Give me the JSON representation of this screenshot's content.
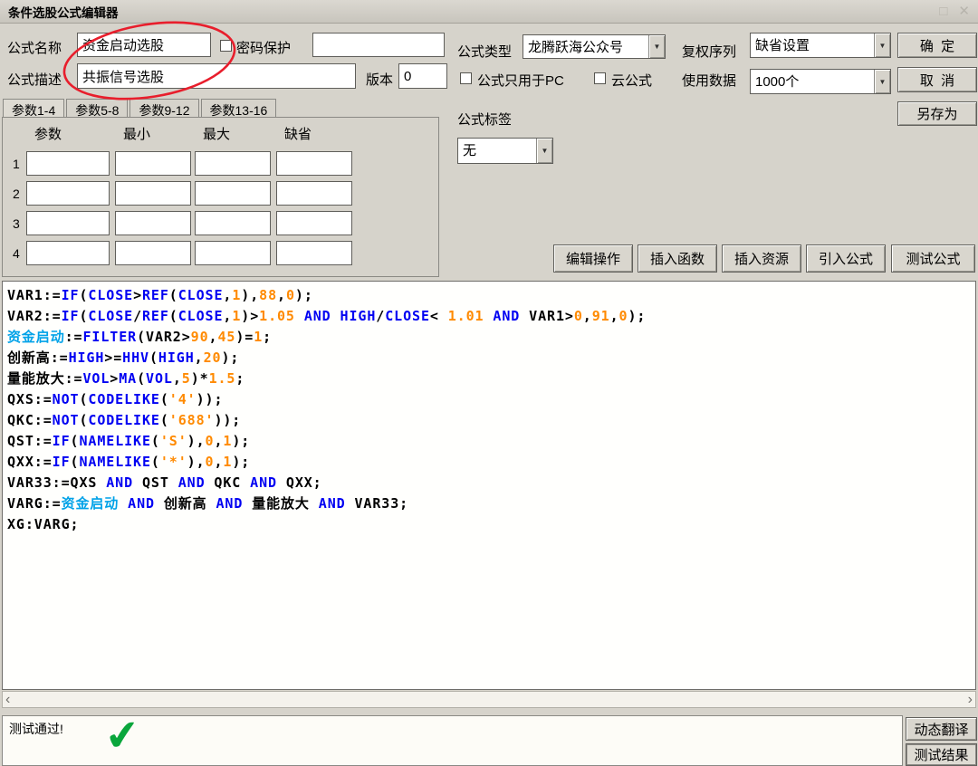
{
  "window": {
    "title": "条件选股公式编辑器",
    "maximize_icon": "□",
    "close_icon": "✕"
  },
  "form": {
    "name": {
      "label": "公式名称",
      "value": "资金启动选股"
    },
    "password": {
      "label": "密码保护",
      "value": "",
      "checked": false
    },
    "desc": {
      "label": "公式描述",
      "value": "共振信号选股"
    },
    "version": {
      "label": "版本",
      "value": "0"
    },
    "type": {
      "label": "公式类型",
      "value": "龙腾跃海公众号"
    },
    "adjust": {
      "label": "复权序列",
      "value": "缺省设置"
    },
    "pc_only": {
      "label": "公式只用于PC",
      "checked": false
    },
    "cloud": {
      "label": "云公式",
      "checked": false
    },
    "data_count": {
      "label": "使用数据",
      "value": "1000个"
    },
    "tag": {
      "label": "公式标签",
      "value": "无"
    }
  },
  "buttons": {
    "ok": "确  定",
    "cancel": "取  消",
    "save_as": "另存为",
    "edit_op": "编辑操作",
    "insert_func": "插入函数",
    "insert_res": "插入资源",
    "import_formula": "引入公式",
    "test_formula": "测试公式",
    "dyn_translate": "动态翻译",
    "test_result": "测试结果"
  },
  "tabs": [
    {
      "label": "参数1-4",
      "active": true
    },
    {
      "label": "参数5-8",
      "active": false
    },
    {
      "label": "参数9-12",
      "active": false
    },
    {
      "label": "参数13-16",
      "active": false
    }
  ],
  "param_table": {
    "headers": [
      "参数",
      "最小",
      "最大",
      "缺省"
    ],
    "row_labels": [
      "1",
      "2",
      "3",
      "4"
    ]
  },
  "code": {
    "lines": [
      [
        [
          "VAR1:=",
          "p"
        ],
        [
          "IF",
          "k"
        ],
        [
          "(",
          "p"
        ],
        [
          "CLOSE",
          "k"
        ],
        [
          ">",
          "p"
        ],
        [
          "REF",
          "k"
        ],
        [
          "(",
          "p"
        ],
        [
          "CLOSE",
          "k"
        ],
        [
          ",",
          "p"
        ],
        [
          "1",
          "n"
        ],
        [
          "),",
          "p"
        ],
        [
          "88",
          "n"
        ],
        [
          ",",
          "p"
        ],
        [
          "0",
          "n"
        ],
        [
          ");",
          "p"
        ]
      ],
      [
        [
          "VAR2:=",
          "p"
        ],
        [
          "IF",
          "k"
        ],
        [
          "(",
          "p"
        ],
        [
          "CLOSE",
          "k"
        ],
        [
          "/",
          "p"
        ],
        [
          "REF",
          "k"
        ],
        [
          "(",
          "p"
        ],
        [
          "CLOSE",
          "k"
        ],
        [
          ",",
          "p"
        ],
        [
          "1",
          "n"
        ],
        [
          ")>",
          "p"
        ],
        [
          "1.05",
          "n"
        ],
        [
          " ",
          "p"
        ],
        [
          "AND",
          "k"
        ],
        [
          " ",
          "p"
        ],
        [
          "HIGH",
          "k"
        ],
        [
          "/",
          "p"
        ],
        [
          "CLOSE",
          "k"
        ],
        [
          "< ",
          "p"
        ],
        [
          "1.01",
          "n"
        ],
        [
          " ",
          "p"
        ],
        [
          "AND",
          "k"
        ],
        [
          " VAR1>",
          "p"
        ],
        [
          "0",
          "n"
        ],
        [
          ",",
          "p"
        ],
        [
          "91",
          "n"
        ],
        [
          ",",
          "p"
        ],
        [
          "0",
          "n"
        ],
        [
          ");",
          "p"
        ]
      ],
      [
        [
          "资金启动",
          "c"
        ],
        [
          ":=",
          "p"
        ],
        [
          "FILTER",
          "k"
        ],
        [
          "(VAR2>",
          "p"
        ],
        [
          "90",
          "n"
        ],
        [
          ",",
          "p"
        ],
        [
          "45",
          "n"
        ],
        [
          ")=",
          "p"
        ],
        [
          "1",
          "n"
        ],
        [
          ";",
          "p"
        ]
      ],
      [
        [
          "创新高:=",
          "p"
        ],
        [
          "HIGH",
          "k"
        ],
        [
          ">=",
          "p"
        ],
        [
          "HHV",
          "k"
        ],
        [
          "(",
          "p"
        ],
        [
          "HIGH",
          "k"
        ],
        [
          ",",
          "p"
        ],
        [
          "20",
          "n"
        ],
        [
          ");",
          "p"
        ]
      ],
      [
        [
          "量能放大:=",
          "p"
        ],
        [
          "VOL",
          "k"
        ],
        [
          ">",
          "p"
        ],
        [
          "MA",
          "k"
        ],
        [
          "(",
          "p"
        ],
        [
          "VOL",
          "k"
        ],
        [
          ",",
          "p"
        ],
        [
          "5",
          "n"
        ],
        [
          ")*",
          "p"
        ],
        [
          "1.5",
          "n"
        ],
        [
          ";",
          "p"
        ]
      ],
      [
        [
          "QXS:=",
          "p"
        ],
        [
          "NOT",
          "k"
        ],
        [
          "(",
          "p"
        ],
        [
          "CODELIKE",
          "k"
        ],
        [
          "(",
          "p"
        ],
        [
          "'4'",
          "n"
        ],
        [
          "));",
          "p"
        ]
      ],
      [
        [
          "QKC:=",
          "p"
        ],
        [
          "NOT",
          "k"
        ],
        [
          "(",
          "p"
        ],
        [
          "CODELIKE",
          "k"
        ],
        [
          "(",
          "p"
        ],
        [
          "'688'",
          "n"
        ],
        [
          "));",
          "p"
        ]
      ],
      [
        [
          "QST:=",
          "p"
        ],
        [
          "IF",
          "k"
        ],
        [
          "(",
          "p"
        ],
        [
          "NAMELIKE",
          "k"
        ],
        [
          "(",
          "p"
        ],
        [
          "'S'",
          "n"
        ],
        [
          "),",
          "p"
        ],
        [
          "0",
          "n"
        ],
        [
          ",",
          "p"
        ],
        [
          "1",
          "n"
        ],
        [
          ");",
          "p"
        ]
      ],
      [
        [
          "QXX:=",
          "p"
        ],
        [
          "IF",
          "k"
        ],
        [
          "(",
          "p"
        ],
        [
          "NAMELIKE",
          "k"
        ],
        [
          "(",
          "p"
        ],
        [
          "'*'",
          "n"
        ],
        [
          "),",
          "p"
        ],
        [
          "0",
          "n"
        ],
        [
          ",",
          "p"
        ],
        [
          "1",
          "n"
        ],
        [
          ");",
          "p"
        ]
      ],
      [
        [
          "VAR33:=QXS ",
          "p"
        ],
        [
          "AND",
          "k"
        ],
        [
          " QST ",
          "p"
        ],
        [
          "AND",
          "k"
        ],
        [
          " QKC ",
          "p"
        ],
        [
          "AND",
          "k"
        ],
        [
          " QXX;",
          "p"
        ]
      ],
      [
        [
          "VARG:=",
          "p"
        ],
        [
          "资金启动",
          "c"
        ],
        [
          " ",
          "p"
        ],
        [
          "AND",
          "k"
        ],
        [
          " 创新高 ",
          "p"
        ],
        [
          "AND",
          "k"
        ],
        [
          " 量能放大 ",
          "p"
        ],
        [
          "AND",
          "k"
        ],
        [
          " VAR33;",
          "p"
        ]
      ],
      [
        [
          "XG:VARG;",
          "p"
        ]
      ]
    ]
  },
  "status": {
    "message": "测试通过!",
    "check_icon": "✔"
  },
  "icons": {
    "dropdown_arrow": "▼",
    "scroll_left": "‹",
    "scroll_right": "›"
  },
  "colors": {
    "keyword": "#0000f2",
    "number_string": "#ff8a00",
    "plain": "#000000",
    "special_var": "#00a2e8",
    "annotation_red": "#e81e2c",
    "check_green": "#0aa63c"
  }
}
